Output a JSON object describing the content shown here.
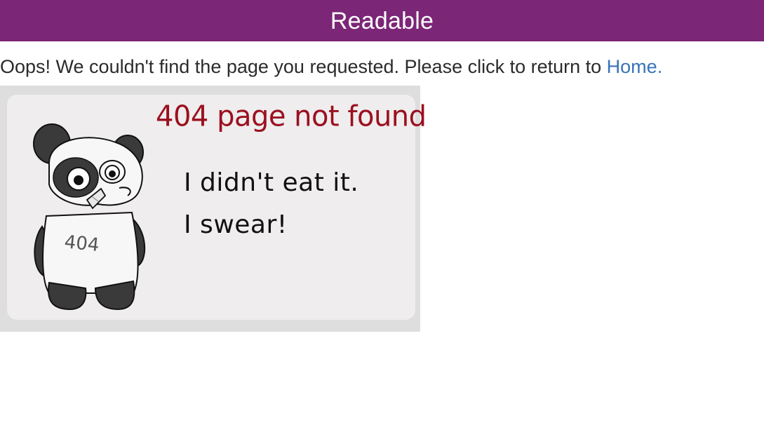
{
  "header": {
    "title": "Readable"
  },
  "message": {
    "text": "Oops! We couldn't find the page you requested. Please click to return to ",
    "link_label": "Home."
  },
  "error_image": {
    "headline": "404 page not found",
    "line_1": "I didn't eat it.",
    "line_2": "I swear!",
    "panda_belly_text": "404",
    "icon": "panda-illustration"
  },
  "colors": {
    "header_bg": "#7b2677",
    "link": "#3873b8",
    "headline": "#9b1020"
  }
}
